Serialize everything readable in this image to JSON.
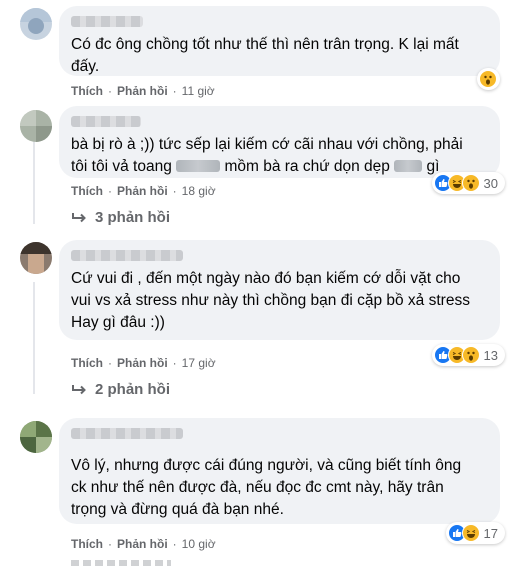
{
  "comments": [
    {
      "text_lines": [
        "Có đc ông chồng tốt như thế thì nên trân trọng. K lại mất",
        "đấy."
      ],
      "actions": {
        "like": "Thích",
        "reply": "Phản hồi",
        "time": "11 giờ"
      },
      "reactions": {
        "types": [
          "wow"
        ],
        "count": ""
      }
    },
    {
      "text_parts": [
        "bà bị rò à ;)) tức sếp lại kiếm cớ cãi nhau với chồng, phải",
        "tôi tôi vả toang",
        "mồm bà ra chứ dọn dẹp",
        "gì"
      ],
      "actions": {
        "like": "Thích",
        "reply": "Phản hồi",
        "time": "18 giờ"
      },
      "reactions": {
        "types": [
          "like",
          "haha",
          "wow"
        ],
        "count": "30"
      },
      "replies": "3 phản hồi"
    },
    {
      "text_lines": [
        "Cứ vui đi , đến một ngày nào đó bạn kiếm cớ dỗi vặt cho",
        "vui vs xả stress như này thì chồng bạn đi cặp bồ xả stress",
        "Hay gì đâu :))"
      ],
      "actions": {
        "like": "Thích",
        "reply": "Phản hồi",
        "time": "17 giờ"
      },
      "reactions": {
        "types": [
          "like",
          "haha",
          "wow"
        ],
        "count": "13"
      },
      "replies": "2 phản hồi"
    },
    {
      "text_lines": [
        "Vô lý, nhưng được cái đúng người, và cũng biết tính ông",
        "ck như thế nên được đà, nếu đọc đc cmt này, hãy trân",
        "trọng và đừng quá đà bạn nhé."
      ],
      "actions": {
        "like": "Thích",
        "reply": "Phản hồi",
        "time": "10 giờ"
      },
      "reactions": {
        "types": [
          "like",
          "haha"
        ],
        "count": "17"
      }
    }
  ],
  "colors": {
    "bubble": "#f0f2f5",
    "meta": "#65676b",
    "like": "#1877f2",
    "emoji": "#f7b928"
  }
}
